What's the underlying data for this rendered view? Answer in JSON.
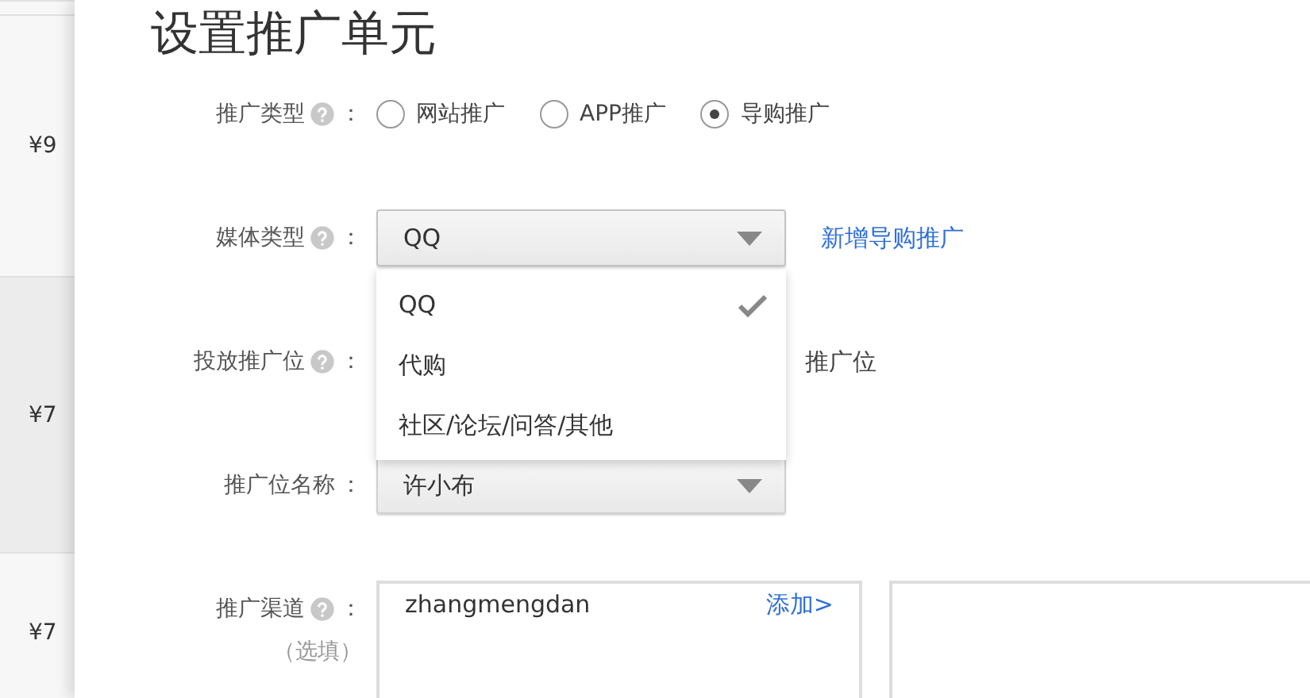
{
  "background_list": {
    "prices": [
      "¥9",
      "¥7",
      "¥7"
    ]
  },
  "title": "设置推广单元",
  "fields": [
    {
      "kind": "radio",
      "label": "推广类型",
      "help": true,
      "colon": "：",
      "options": [
        {
          "label": "网站推广",
          "selected": false
        },
        {
          "label": "APP推广",
          "selected": false
        },
        {
          "label": "导购推广",
          "selected": true
        }
      ]
    },
    {
      "kind": "select",
      "label": "媒体类型",
      "help": true,
      "colon": "：",
      "value": "QQ",
      "expanded": true,
      "options": [
        {
          "label": "QQ",
          "selected": true
        },
        {
          "label": "代购",
          "selected": false
        },
        {
          "label": "社区/论坛/问答/其他",
          "selected": false
        }
      ],
      "link": "新增导购推广"
    },
    {
      "kind": "select",
      "label": "投放推广位",
      "help": true,
      "colon": "：",
      "note": "推广位"
    },
    {
      "kind": "select",
      "label": "推广位名称",
      "help": false,
      "colon": "：",
      "value": "许小布"
    },
    {
      "kind": "channel",
      "label": "推广渠道",
      "help": true,
      "colon": "：",
      "hint": "（选填）",
      "value": "zhangmengdan",
      "link": "添加>"
    }
  ]
}
